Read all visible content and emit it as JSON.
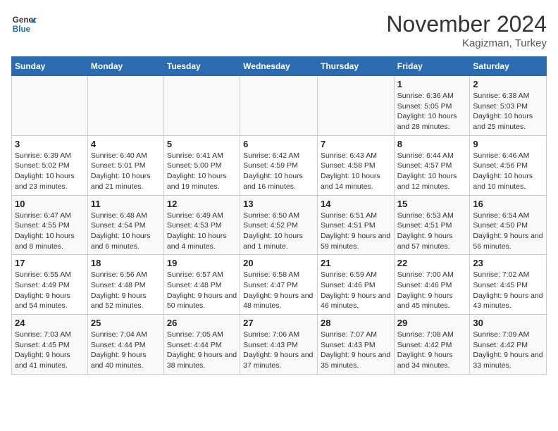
{
  "header": {
    "logo_text_general": "General",
    "logo_text_blue": "Blue",
    "month_title": "November 2024",
    "subtitle": "Kagizman, Turkey"
  },
  "weekdays": [
    "Sunday",
    "Monday",
    "Tuesday",
    "Wednesday",
    "Thursday",
    "Friday",
    "Saturday"
  ],
  "weeks": [
    [
      {
        "day": "",
        "info": ""
      },
      {
        "day": "",
        "info": ""
      },
      {
        "day": "",
        "info": ""
      },
      {
        "day": "",
        "info": ""
      },
      {
        "day": "",
        "info": ""
      },
      {
        "day": "1",
        "info": "Sunrise: 6:36 AM\nSunset: 5:05 PM\nDaylight: 10 hours and 28 minutes."
      },
      {
        "day": "2",
        "info": "Sunrise: 6:38 AM\nSunset: 5:03 PM\nDaylight: 10 hours and 25 minutes."
      }
    ],
    [
      {
        "day": "3",
        "info": "Sunrise: 6:39 AM\nSunset: 5:02 PM\nDaylight: 10 hours and 23 minutes."
      },
      {
        "day": "4",
        "info": "Sunrise: 6:40 AM\nSunset: 5:01 PM\nDaylight: 10 hours and 21 minutes."
      },
      {
        "day": "5",
        "info": "Sunrise: 6:41 AM\nSunset: 5:00 PM\nDaylight: 10 hours and 19 minutes."
      },
      {
        "day": "6",
        "info": "Sunrise: 6:42 AM\nSunset: 4:59 PM\nDaylight: 10 hours and 16 minutes."
      },
      {
        "day": "7",
        "info": "Sunrise: 6:43 AM\nSunset: 4:58 PM\nDaylight: 10 hours and 14 minutes."
      },
      {
        "day": "8",
        "info": "Sunrise: 6:44 AM\nSunset: 4:57 PM\nDaylight: 10 hours and 12 minutes."
      },
      {
        "day": "9",
        "info": "Sunrise: 6:46 AM\nSunset: 4:56 PM\nDaylight: 10 hours and 10 minutes."
      }
    ],
    [
      {
        "day": "10",
        "info": "Sunrise: 6:47 AM\nSunset: 4:55 PM\nDaylight: 10 hours and 8 minutes."
      },
      {
        "day": "11",
        "info": "Sunrise: 6:48 AM\nSunset: 4:54 PM\nDaylight: 10 hours and 6 minutes."
      },
      {
        "day": "12",
        "info": "Sunrise: 6:49 AM\nSunset: 4:53 PM\nDaylight: 10 hours and 4 minutes."
      },
      {
        "day": "13",
        "info": "Sunrise: 6:50 AM\nSunset: 4:52 PM\nDaylight: 10 hours and 1 minute."
      },
      {
        "day": "14",
        "info": "Sunrise: 6:51 AM\nSunset: 4:51 PM\nDaylight: 9 hours and 59 minutes."
      },
      {
        "day": "15",
        "info": "Sunrise: 6:53 AM\nSunset: 4:51 PM\nDaylight: 9 hours and 57 minutes."
      },
      {
        "day": "16",
        "info": "Sunrise: 6:54 AM\nSunset: 4:50 PM\nDaylight: 9 hours and 56 minutes."
      }
    ],
    [
      {
        "day": "17",
        "info": "Sunrise: 6:55 AM\nSunset: 4:49 PM\nDaylight: 9 hours and 54 minutes."
      },
      {
        "day": "18",
        "info": "Sunrise: 6:56 AM\nSunset: 4:48 PM\nDaylight: 9 hours and 52 minutes."
      },
      {
        "day": "19",
        "info": "Sunrise: 6:57 AM\nSunset: 4:48 PM\nDaylight: 9 hours and 50 minutes."
      },
      {
        "day": "20",
        "info": "Sunrise: 6:58 AM\nSunset: 4:47 PM\nDaylight: 9 hours and 48 minutes."
      },
      {
        "day": "21",
        "info": "Sunrise: 6:59 AM\nSunset: 4:46 PM\nDaylight: 9 hours and 46 minutes."
      },
      {
        "day": "22",
        "info": "Sunrise: 7:00 AM\nSunset: 4:46 PM\nDaylight: 9 hours and 45 minutes."
      },
      {
        "day": "23",
        "info": "Sunrise: 7:02 AM\nSunset: 4:45 PM\nDaylight: 9 hours and 43 minutes."
      }
    ],
    [
      {
        "day": "24",
        "info": "Sunrise: 7:03 AM\nSunset: 4:45 PM\nDaylight: 9 hours and 41 minutes."
      },
      {
        "day": "25",
        "info": "Sunrise: 7:04 AM\nSunset: 4:44 PM\nDaylight: 9 hours and 40 minutes."
      },
      {
        "day": "26",
        "info": "Sunrise: 7:05 AM\nSunset: 4:44 PM\nDaylight: 9 hours and 38 minutes."
      },
      {
        "day": "27",
        "info": "Sunrise: 7:06 AM\nSunset: 4:43 PM\nDaylight: 9 hours and 37 minutes."
      },
      {
        "day": "28",
        "info": "Sunrise: 7:07 AM\nSunset: 4:43 PM\nDaylight: 9 hours and 35 minutes."
      },
      {
        "day": "29",
        "info": "Sunrise: 7:08 AM\nSunset: 4:42 PM\nDaylight: 9 hours and 34 minutes."
      },
      {
        "day": "30",
        "info": "Sunrise: 7:09 AM\nSunset: 4:42 PM\nDaylight: 9 hours and 33 minutes."
      }
    ]
  ]
}
